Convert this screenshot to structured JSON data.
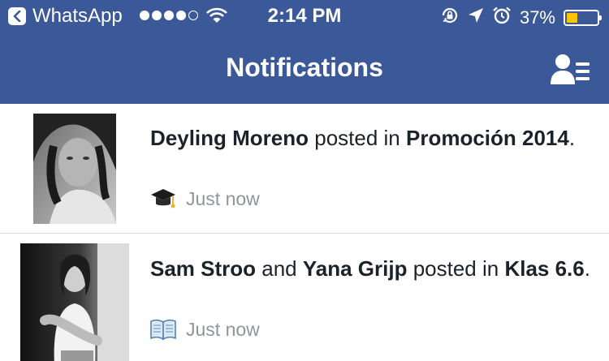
{
  "status_bar": {
    "back_app": "WhatsApp",
    "time": "2:14 PM",
    "battery": "37%",
    "battery_level": 0.37
  },
  "header": {
    "title": "Notifications",
    "friends_icon": "friend-requests-icon"
  },
  "notifications": [
    {
      "actor1": "Deyling Moreno",
      "conj": "",
      "actor2": "",
      "verb": " posted in ",
      "group": "Promoción 2014",
      "end": ".",
      "time": "Just now",
      "icon": "graduation-cap-icon"
    },
    {
      "actor1": "Sam Stroo",
      "conj": " and ",
      "actor2": "Yana Grijp",
      "verb": " posted in ",
      "group": "Klas 6.6",
      "end": ".",
      "time": "Just now",
      "icon": "book-icon"
    }
  ],
  "colors": {
    "brand": "#3b5998",
    "battery_fill": "#f7c500",
    "meta_text": "#90949c"
  }
}
